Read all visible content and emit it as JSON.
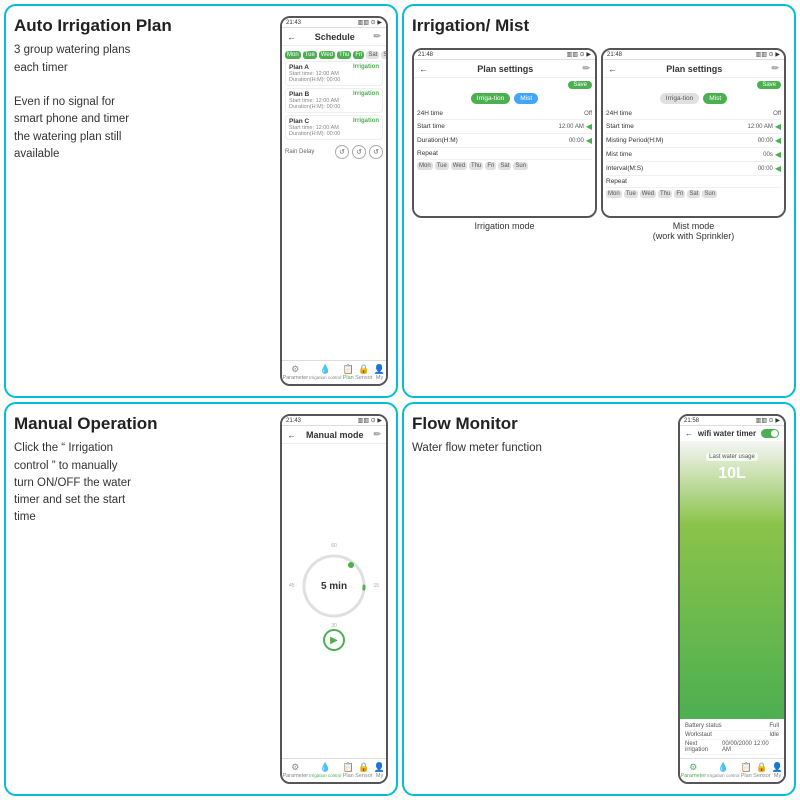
{
  "cards": {
    "auto_irrigation": {
      "title": "Auto Irrigation Plan",
      "body_line1": "3 group watering plans",
      "body_line2": "each timer",
      "body_line3": "Even if no signal for",
      "body_line4": "smart phone and timer",
      "body_line5": "the watering plan still",
      "body_line6": "available",
      "phone": {
        "status": "21:43",
        "title": "Schedule",
        "days": [
          "Mon",
          "Tue",
          "Wed",
          "Thu",
          "Fri",
          "Sat",
          "Sun"
        ],
        "plans": [
          {
            "name": "Plan A",
            "type": "Irrigation",
            "time": "Start time: 12:00 AM",
            "duration": "Duration(H:M): 00:00"
          },
          {
            "name": "Plan B",
            "type": "Irrigation",
            "time": "Start time: 12:00 AM",
            "duration": "Duration(H:M): 00:00"
          },
          {
            "name": "Plan C",
            "type": "Irrigation",
            "time": "Start time: 12:00 AM",
            "duration": "Duration(H:M): 00:00"
          }
        ],
        "rain_delay": "Rain Delay",
        "footer": [
          {
            "label": "Parameter",
            "active": false
          },
          {
            "label": "Irrigation control",
            "active": false
          },
          {
            "label": "Plan",
            "active": true
          },
          {
            "label": "Sensor",
            "active": false
          },
          {
            "label": "My",
            "active": false
          }
        ]
      }
    },
    "irrigation_mist": {
      "title": "Irrigation/ Mist",
      "phone_irrigation": {
        "status": "21:48",
        "title": "Plan settings",
        "save": "Save",
        "mode1": "Irriga-tion",
        "mode2": "Mist",
        "rows": [
          {
            "label": "24H time",
            "val": "Off"
          },
          {
            "label": "Start time",
            "val": "12:00 AM"
          },
          {
            "label": "Duration(H:M)",
            "val": "00:00"
          },
          {
            "label": "Repeat",
            "val": ""
          }
        ],
        "days": [
          "Mon",
          "Tue",
          "Wed",
          "Thu",
          "Fri",
          "Sat",
          "Sun"
        ]
      },
      "phone_mist": {
        "status": "21:48",
        "title": "Plan settings",
        "save": "Save",
        "mode1": "Irriga-tion",
        "mode2": "Mist",
        "rows": [
          {
            "label": "24H time",
            "val": "Off"
          },
          {
            "label": "Start time",
            "val": "12:00 AM"
          },
          {
            "label": "Misting Period(H:M)",
            "val": "00:00"
          },
          {
            "label": "Mist time",
            "val": "00s"
          },
          {
            "label": "Interval(M:S)",
            "val": "00:00"
          },
          {
            "label": "Repeat",
            "val": ""
          }
        ],
        "days": [
          "Mon",
          "Tue",
          "Wed",
          "Thu",
          "Fri",
          "Sat",
          "Sun"
        ]
      },
      "label_irrigation": "Irrigation mode",
      "label_mist": "Mist mode\n(work with Sprinkler)"
    },
    "manual": {
      "title": "Manual Operation",
      "body_line1": "Click the “ Irrigation",
      "body_line2": "control ” to manually",
      "body_line3": "turn ON/OFF the water",
      "body_line4": "timer and set the start",
      "body_line5": "time",
      "phone": {
        "status": "21:43",
        "title": "Manual mode",
        "dial_value": "5 min",
        "dial_top": "60",
        "dial_right": "15",
        "dial_bottom": "30",
        "dial_left": "45",
        "footer": [
          {
            "label": "Parameter",
            "active": false
          },
          {
            "label": "Irrigation control",
            "active": true
          },
          {
            "label": "Plan",
            "active": false
          },
          {
            "label": "Sensor",
            "active": false
          },
          {
            "label": "My",
            "active": false
          }
        ]
      }
    },
    "flow": {
      "title": "Flow Monitor",
      "body": "Water flow meter function",
      "phone": {
        "status": "21:58",
        "title": "wifi water timer",
        "last_label": "Last water usage",
        "value": "10L",
        "battery_label": "Battery status",
        "battery_val": "Full",
        "workstaut_label": "Workstaut",
        "workstaut_val": "Idle",
        "next_label": "Next irrigation",
        "next_val": "00/00/2000 12:00 AM",
        "footer": [
          {
            "label": "Parameter",
            "active": true
          },
          {
            "label": "Irrigation control",
            "active": false
          },
          {
            "label": "Plan",
            "active": false
          },
          {
            "label": "Sensor",
            "active": false
          },
          {
            "label": "My",
            "active": false
          }
        ]
      }
    }
  }
}
